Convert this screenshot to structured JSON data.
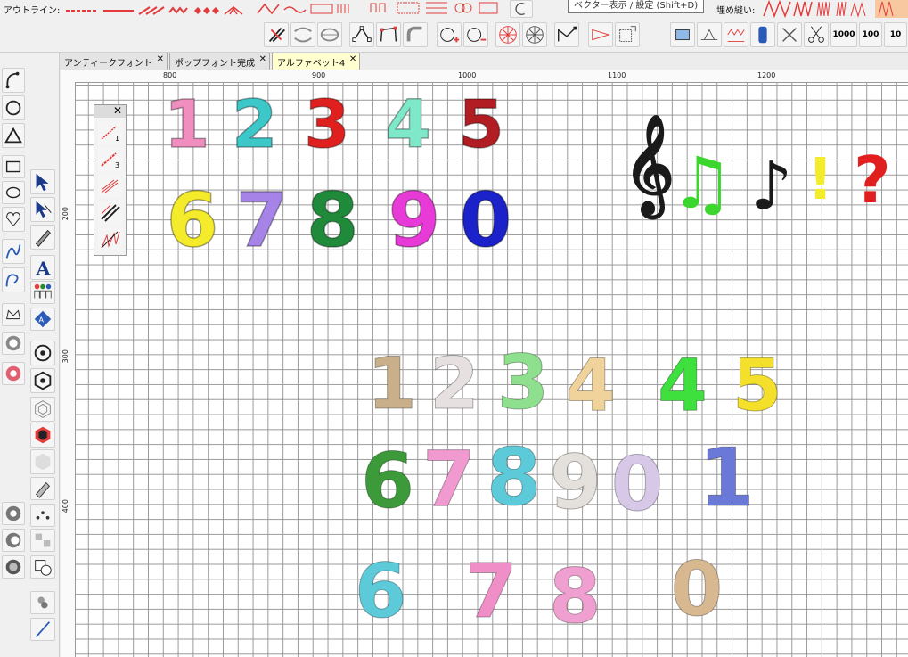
{
  "toolbar": {
    "outline_label": "アウトライン:",
    "fill_label": "埋め縫い:",
    "tooltip": "ベクター表示 / 設定 (Shift+D)",
    "fill_counts": [
      "1000",
      "100",
      "10"
    ]
  },
  "tabs": [
    {
      "label": "アンティークフォント",
      "active": false
    },
    {
      "label": "ポップフォント完成",
      "active": false
    },
    {
      "label": "アルファベット4",
      "active": true
    }
  ],
  "ruler": {
    "h_labels": [
      "800",
      "900",
      "1000",
      "1100",
      "1200"
    ],
    "v_labels": [
      "200",
      "300",
      "400"
    ]
  },
  "palette": {
    "tool_numbers": [
      "1",
      "3"
    ]
  },
  "colors": {
    "accent_red": "#e23b3b",
    "tab_active_bg": "#ffffcf",
    "grid_line": "#9a9a9a"
  },
  "canvas": {
    "pop_digits_row1": [
      {
        "char": "1",
        "color": "#f08ec0"
      },
      {
        "char": "2",
        "color": "#3cc7c9"
      },
      {
        "char": "3",
        "color": "#e01f1f"
      },
      {
        "char": "4",
        "color": "#7fe8c8"
      },
      {
        "char": "5",
        "color": "#b21d24"
      }
    ],
    "pop_digits_row2": [
      {
        "char": "6",
        "color": "#f4ec2a"
      },
      {
        "char": "7",
        "color": "#a683e6"
      },
      {
        "char": "8",
        "color": "#1f8a3a"
      },
      {
        "char": "9",
        "color": "#e83ad6"
      },
      {
        "char": "0",
        "color": "#1b22c9"
      }
    ],
    "symbols": [
      {
        "char": "𝄞",
        "color": "#1a1a1a"
      },
      {
        "char": "♫",
        "color": "#3bd62e"
      },
      {
        "char": "♪",
        "color": "#1a1a1a"
      },
      {
        "char": "!",
        "color": "#f4ec2a"
      },
      {
        "char": "?",
        "color": "#e01f1f"
      }
    ],
    "animal_row1": [
      {
        "char": "1",
        "color": "#c9b08a"
      },
      {
        "char": "2",
        "color": "#e6e0e0"
      },
      {
        "char": "3",
        "color": "#8ee08e"
      },
      {
        "char": "4",
        "color": "#f0d39a"
      },
      {
        "char": "4",
        "color": "#3ee03e"
      },
      {
        "char": "5",
        "color": "#f4e02a"
      }
    ],
    "animal_row2": [
      {
        "char": "6",
        "color": "#3c9a3a"
      },
      {
        "char": "7",
        "color": "#f09ad0"
      },
      {
        "char": "8",
        "color": "#5ccad8"
      },
      {
        "char": "9",
        "color": "#e4e0dc"
      },
      {
        "char": "0",
        "color": "#d8c8e8"
      },
      {
        "char": "1",
        "color": "#6a78d8"
      }
    ],
    "animal_row3": [
      {
        "char": "6",
        "color": "#5ccad8"
      },
      {
        "char": "7",
        "color": "#f08ec8"
      },
      {
        "char": "8",
        "color": "#f0a0d0"
      },
      {
        "char": "0",
        "color": "#d8b890"
      }
    ]
  }
}
